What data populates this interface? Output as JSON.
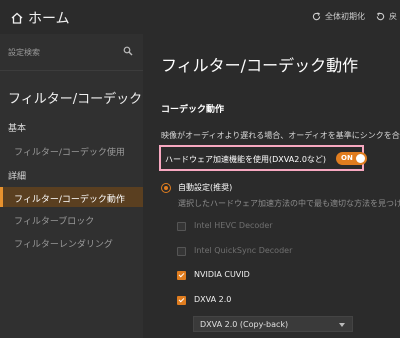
{
  "header": {
    "home_label": "ホーム",
    "reset_label": "全体初期化",
    "return_label": "戻"
  },
  "sidebar": {
    "search_placeholder": "設定検索",
    "title": "フィルター/コーデック",
    "section_basic": "基本",
    "section_detail": "詳細",
    "items": [
      {
        "label": "フィルター/コーデック使用"
      },
      {
        "label": "フィルター/コーデック動作"
      },
      {
        "label": "フィルターブロック"
      },
      {
        "label": "フィルターレンダリング"
      }
    ]
  },
  "main": {
    "title": "フィルター/コーデック動作",
    "group_title": "コーデック動作",
    "sync_desc": "映像がオーディオより遅れる場合、オーディオを基準にシンクを合",
    "hw_label": "ハードウェア加速機能を使用(DXVA2.0など)",
    "toggle_text": "ON",
    "radio_label": "自動設定(推奨)",
    "radio_desc": "選択したハードウェア加速方法の中で最も適切な方法を見つけ",
    "options": [
      {
        "label": "Intel HEVC Decoder",
        "checked": false
      },
      {
        "label": "Intel QuickSync Decoder",
        "checked": false
      },
      {
        "label": "NVIDIA CUVID",
        "checked": true
      },
      {
        "label": "DXVA 2.0",
        "checked": true
      }
    ],
    "dxva_select": "DXVA 2.0 (Copy-back)"
  },
  "colors": {
    "accent": "#e07d1f",
    "highlight_border": "#f7a8c0",
    "active_bg": "#5a3f20"
  }
}
